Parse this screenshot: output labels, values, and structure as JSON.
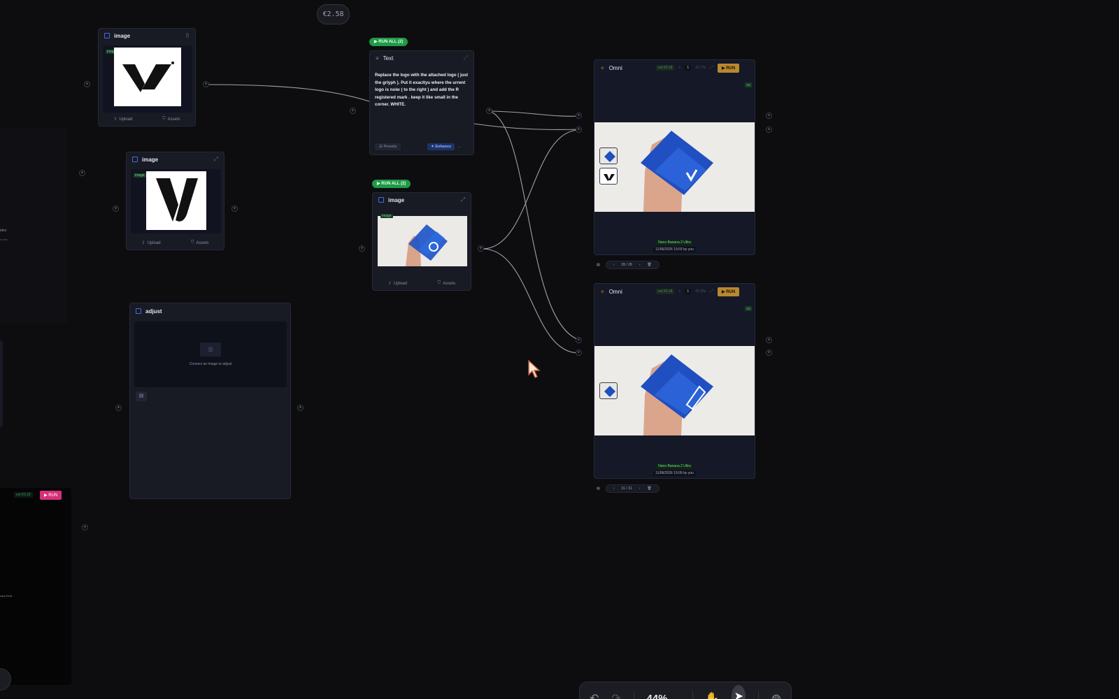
{
  "cost_badge": "€2.58",
  "image_node_1": {
    "title": "image",
    "tag": "image",
    "upload": "Upload",
    "assets": "Assets"
  },
  "image_node_2": {
    "title": "image",
    "tag": "image",
    "upload": "Upload",
    "assets": "Assets"
  },
  "image_node_3": {
    "title": "image",
    "tag": "image",
    "upload": "Upload",
    "assets": "Assets",
    "run_all": "▶ RUN ALL (2)"
  },
  "text_node": {
    "run_all": "▶ RUN ALL (2)",
    "title": "Text",
    "prompt": "Replace the logo with the attached logo ( just the grlyph ). Put it exacltyu where the urrent logo is noiw ( to the right ) and add the R registered mark . keep it like small in the corner. WHITE.",
    "presets": "Presets",
    "enhance": "Enhance",
    "more": "..."
  },
  "adjust_node": {
    "title": "adjust",
    "placeholder": "Connect an image to adjust"
  },
  "omni_1": {
    "title": "Omni",
    "cost": "est €0.18",
    "count": "1",
    "time": "42.77s",
    "run": "▶ RUN",
    "badge": "SD",
    "model": "Nano Banana 2 Ultra",
    "date": "11/06/2026 19:03",
    "by": "by you",
    "page": "28 / 28"
  },
  "omni_2": {
    "title": "Omni",
    "cost": "est €0.18",
    "count": "1",
    "time": "45.30s",
    "run": "▶ RUN",
    "badge": "SD",
    "model": "Nano Banana 2 Ultra",
    "date": "11/06/2026 19:09",
    "by": "by you",
    "page": "31 / 31"
  },
  "left_partial": {
    "label_a": "ides",
    "label_b": "nodes",
    "cost": "est €0.18",
    "run": "▶ RUN",
    "hint": "click RUN"
  },
  "toolbar": {
    "zoom": "44%"
  },
  "colors": {
    "run_all": "#1f9a47",
    "run": "#b88830",
    "pink_run": "#d6307a",
    "canvas": "#0d0d0f",
    "node": "#181a24"
  }
}
